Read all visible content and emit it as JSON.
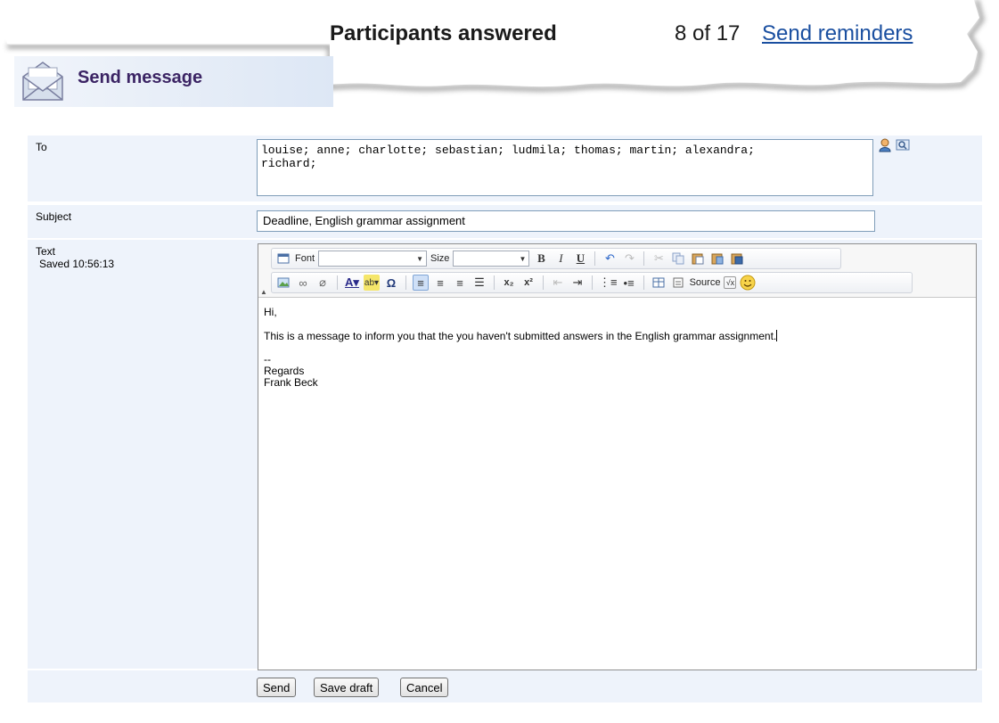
{
  "header": {
    "stats_title": "Participants answered",
    "stats_count": "8 of 17",
    "reminders_link": "Send reminders"
  },
  "panel": {
    "title": "Send message"
  },
  "form": {
    "to_label": "To",
    "to_value": "louise; anne; charlotte; sebastian; ludmila; thomas; martin; alexandra;\nrichard;",
    "subject_label": "Subject",
    "subject_value": "Deadline, English grammar assignment",
    "text_label": "Text",
    "saved_status": "Saved 10:56:13"
  },
  "toolbar": {
    "font_label": "Font",
    "size_label": "Size",
    "source_label": "Source"
  },
  "editor": {
    "line1": "Hi,",
    "line2": "This is a message to inform you that the you haven't submitted answers in the English grammar assignment.",
    "line3": "--",
    "line4": "Regards",
    "line5": "Frank Beck"
  },
  "buttons": {
    "send": "Send",
    "save_draft": "Save draft",
    "cancel": "Cancel"
  },
  "colors": {
    "link": "#1a4fa0",
    "panel_title": "#3b2464",
    "row_bg": "#eef3fb",
    "field_border": "#7f9db9"
  }
}
